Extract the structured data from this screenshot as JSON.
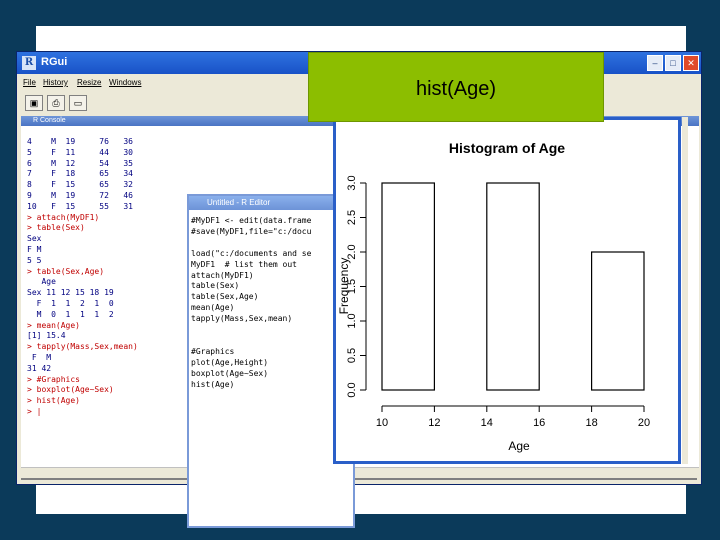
{
  "callout": {
    "text": "hist(Age)"
  },
  "rgui": {
    "title": "RGui",
    "menu": [
      "File",
      "History",
      "Resize",
      "Windows"
    ]
  },
  "console": {
    "title": "R Console",
    "lines": [
      {
        "kind": "out",
        "text": "4    M  19     76   36"
      },
      {
        "kind": "out",
        "text": "5    F  11     44   30"
      },
      {
        "kind": "out",
        "text": "6    M  12     54   35"
      },
      {
        "kind": "out",
        "text": "7    F  18     65   34"
      },
      {
        "kind": "out",
        "text": "8    F  15     65   32"
      },
      {
        "kind": "out",
        "text": "9    M  19     72   46"
      },
      {
        "kind": "out",
        "text": "10   F  15     55   31"
      },
      {
        "kind": "cmd",
        "text": "> attach(MyDF1)"
      },
      {
        "kind": "cmd",
        "text": "> table(Sex)"
      },
      {
        "kind": "out",
        "text": "Sex"
      },
      {
        "kind": "out",
        "text": "F M"
      },
      {
        "kind": "out",
        "text": "5 5"
      },
      {
        "kind": "cmd",
        "text": "> table(Sex,Age)"
      },
      {
        "kind": "out",
        "text": "   Age"
      },
      {
        "kind": "out",
        "text": "Sex 11 12 15 18 19"
      },
      {
        "kind": "out",
        "text": "  F  1  1  2  1  0"
      },
      {
        "kind": "out",
        "text": "  M  0  1  1  1  2"
      },
      {
        "kind": "cmd",
        "text": "> mean(Age)"
      },
      {
        "kind": "out",
        "text": "[1] 15.4"
      },
      {
        "kind": "cmd",
        "text": "> tapply(Mass,Sex,mean)"
      },
      {
        "kind": "out",
        "text": " F  M"
      },
      {
        "kind": "out",
        "text": "31 42"
      },
      {
        "kind": "cmd",
        "text": "> #Graphics"
      },
      {
        "kind": "cmd",
        "text": "> boxplot(Age~Sex)"
      },
      {
        "kind": "cmd",
        "text": "> hist(Age)"
      },
      {
        "kind": "cmd",
        "text": "> |"
      }
    ]
  },
  "editor": {
    "title": "Untitled - R Editor",
    "lines": [
      "#MyDF1 <- edit(data.frame",
      "#save(MyDF1,file=\"c:/docu",
      "",
      "load(\"c:/documents and se",
      "MyDF1  # list them out",
      "attach(MyDF1)",
      "table(Sex)",
      "table(Sex,Age)",
      "mean(Age)",
      "tapply(Mass,Sex,mean)",
      "",
      "",
      "#Graphics",
      "plot(Age,Height)",
      "boxplot(Age~Sex)",
      "hist(Age)"
    ]
  },
  "chart_data": {
    "type": "bar",
    "title": "Histogram of Age",
    "xlabel": "Age",
    "ylabel": "Frequency",
    "bins": [
      [
        10,
        12
      ],
      [
        12,
        14
      ],
      [
        14,
        16
      ],
      [
        16,
        18
      ],
      [
        18,
        20
      ]
    ],
    "values": [
      3,
      0,
      3,
      0,
      2
    ],
    "xlim": [
      10,
      20
    ],
    "ylim": [
      0,
      3
    ],
    "xticks": [
      "10",
      "12",
      "14",
      "16",
      "18",
      "20"
    ],
    "yticks": [
      "0.0",
      "0.5",
      "1.0",
      "1.5",
      "2.0",
      "2.5",
      "3.0"
    ],
    "grid": false
  }
}
